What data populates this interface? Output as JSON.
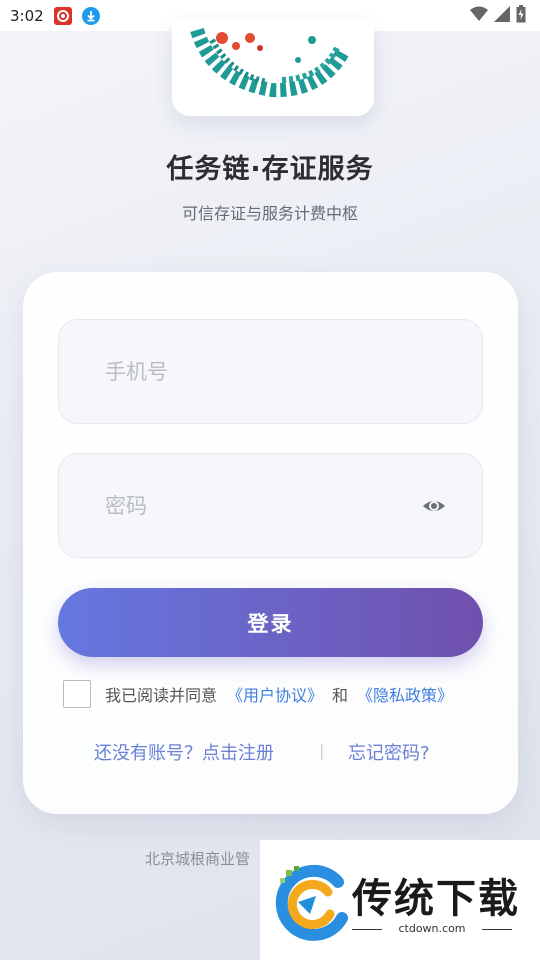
{
  "status_bar": {
    "time": "3:02",
    "icons": [
      "app-notification-icon",
      "download-icon",
      "wifi-icon",
      "signal-icon",
      "battery-icon"
    ]
  },
  "header": {
    "title": "任务链·存证服务",
    "subtitle": "可信存证与服务计费中枢"
  },
  "form": {
    "phone_placeholder": "手机号",
    "password_placeholder": "密码",
    "login_label": "登录",
    "agree_text": "我已阅读并同意",
    "user_agreement": "《用户协议》",
    "and_text": "和",
    "privacy_policy": "《隐私政策》",
    "register_link": "还没有账号？点击注册",
    "divider": "|",
    "forgot_link": "忘记密码?"
  },
  "footer": {
    "text": "北京城根商业管"
  },
  "watermark": {
    "brand": "传统下载",
    "url": "ctdown.com"
  },
  "colors": {
    "accent_start": "#6578e0",
    "accent_end": "#7050ad",
    "link": "#3e7fe0"
  }
}
